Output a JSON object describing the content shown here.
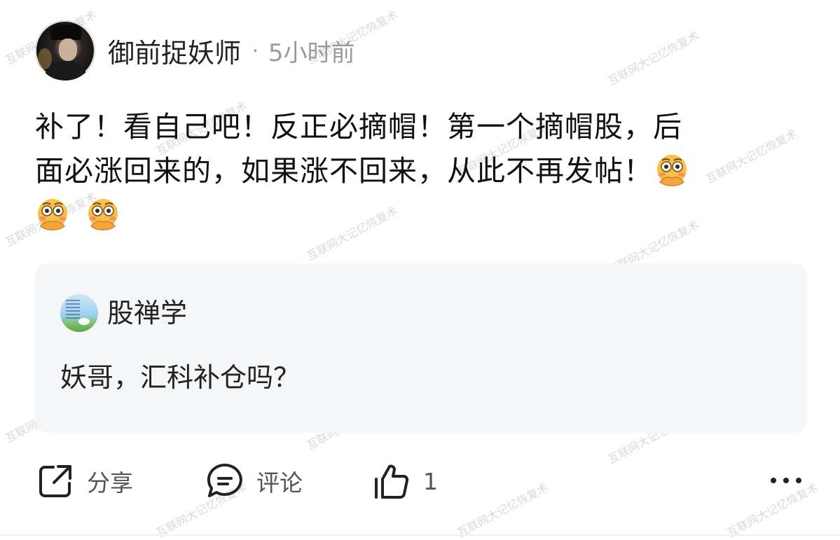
{
  "post": {
    "author": "御前捉妖师",
    "separator": "·",
    "time": "5小时前",
    "text_line1": "补了！看自己吧！反正必摘帽！第一个摘帽股，后",
    "text_line2": "面必涨回来的，如果涨不回来，从此不再发帖！",
    "emoji_name": "flushed-hands-emoji"
  },
  "reply": {
    "author": "股禅学",
    "text": "妖哥，汇科补仓吗？"
  },
  "actions": {
    "share_label": "分享",
    "comment_label": "评论",
    "like_count": "1"
  },
  "watermark": "互联网大记忆恢复术",
  "colors": {
    "text": "#111111",
    "muted": "#9a9a9a",
    "card_bg": "#f5f6f8",
    "emoji_face": "#f7c04a",
    "emoji_blush": "#f08a5d"
  }
}
